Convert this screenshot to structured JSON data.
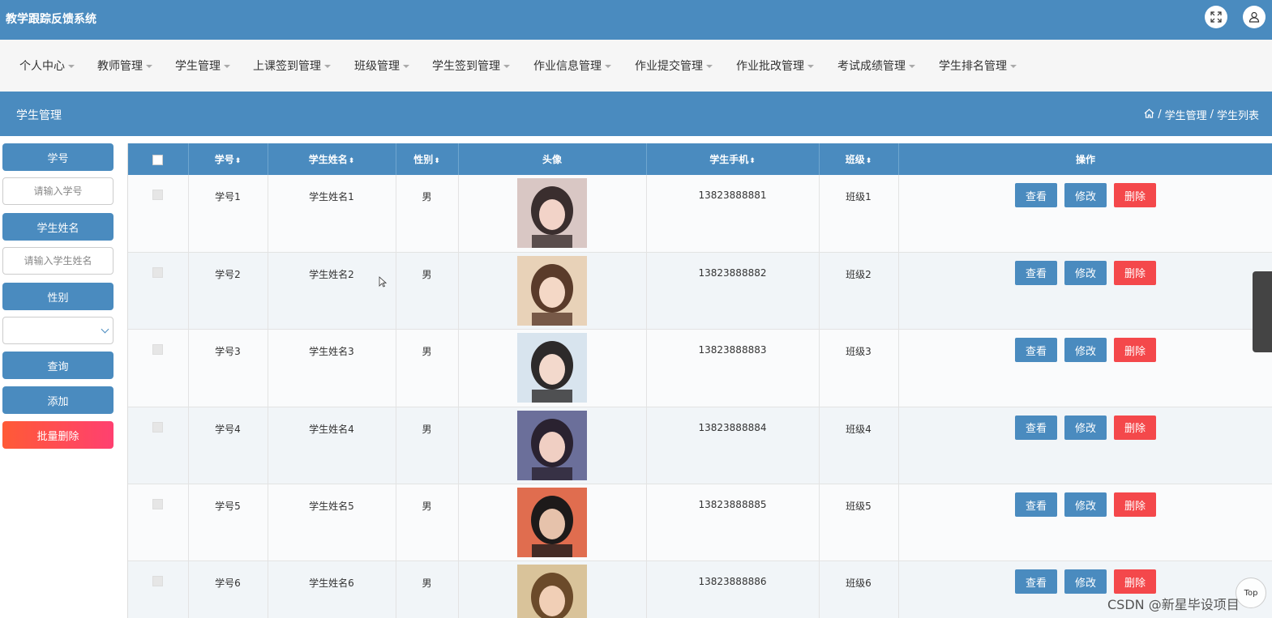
{
  "app": {
    "title": "教学跟踪反馈系统"
  },
  "header_icons": [
    "fullscreen-icon",
    "user-icon"
  ],
  "menu": [
    {
      "label": "个人中心"
    },
    {
      "label": "教师管理"
    },
    {
      "label": "学生管理"
    },
    {
      "label": "上课签到管理"
    },
    {
      "label": "班级管理"
    },
    {
      "label": "学生签到管理"
    },
    {
      "label": "作业信息管理"
    },
    {
      "label": "作业提交管理"
    },
    {
      "label": "作业批改管理"
    },
    {
      "label": "考试成绩管理"
    },
    {
      "label": "学生排名管理"
    }
  ],
  "page": {
    "title": "学生管理",
    "breadcrumb": [
      "学生管理",
      "学生列表"
    ],
    "breadcrumb_sep": "/"
  },
  "filters": {
    "student_no_label": "学号",
    "student_no_placeholder": "请输入学号",
    "student_name_label": "学生姓名",
    "student_name_placeholder": "请输入学生姓名",
    "gender_label": "性别",
    "gender_value": "",
    "search_button": "查询",
    "add_button": "添加",
    "batch_delete_button": "批量删除"
  },
  "table": {
    "columns": [
      "学号",
      "学生姓名",
      "性别",
      "头像",
      "学生手机",
      "班级",
      "操作"
    ],
    "sortable": [
      true,
      true,
      true,
      false,
      true,
      true,
      false
    ],
    "rows": [
      {
        "no": "学号1",
        "name": "学生姓名1",
        "gender": "男",
        "phone": "13823888881",
        "class": "班级1"
      },
      {
        "no": "学号2",
        "name": "学生姓名2",
        "gender": "男",
        "phone": "13823888882",
        "class": "班级2"
      },
      {
        "no": "学号3",
        "name": "学生姓名3",
        "gender": "男",
        "phone": "13823888883",
        "class": "班级3"
      },
      {
        "no": "学号4",
        "name": "学生姓名4",
        "gender": "男",
        "phone": "13823888884",
        "class": "班级4"
      },
      {
        "no": "学号5",
        "name": "学生姓名5",
        "gender": "男",
        "phone": "13823888885",
        "class": "班级5"
      },
      {
        "no": "学号6",
        "name": "学生姓名6",
        "gender": "男",
        "phone": "13823888886",
        "class": "班级6"
      }
    ],
    "actions": {
      "view": "查看",
      "edit": "修改",
      "delete": "删除"
    },
    "sort_glyph": "⬍"
  },
  "misc": {
    "top_button": "Top",
    "watermark": "CSDN @新星毕设项目"
  },
  "colors": {
    "primary": "#4a8bbf",
    "danger": "#f4484b",
    "batch_delete_gradient": [
      "#ff5a36",
      "#ff4070"
    ]
  }
}
